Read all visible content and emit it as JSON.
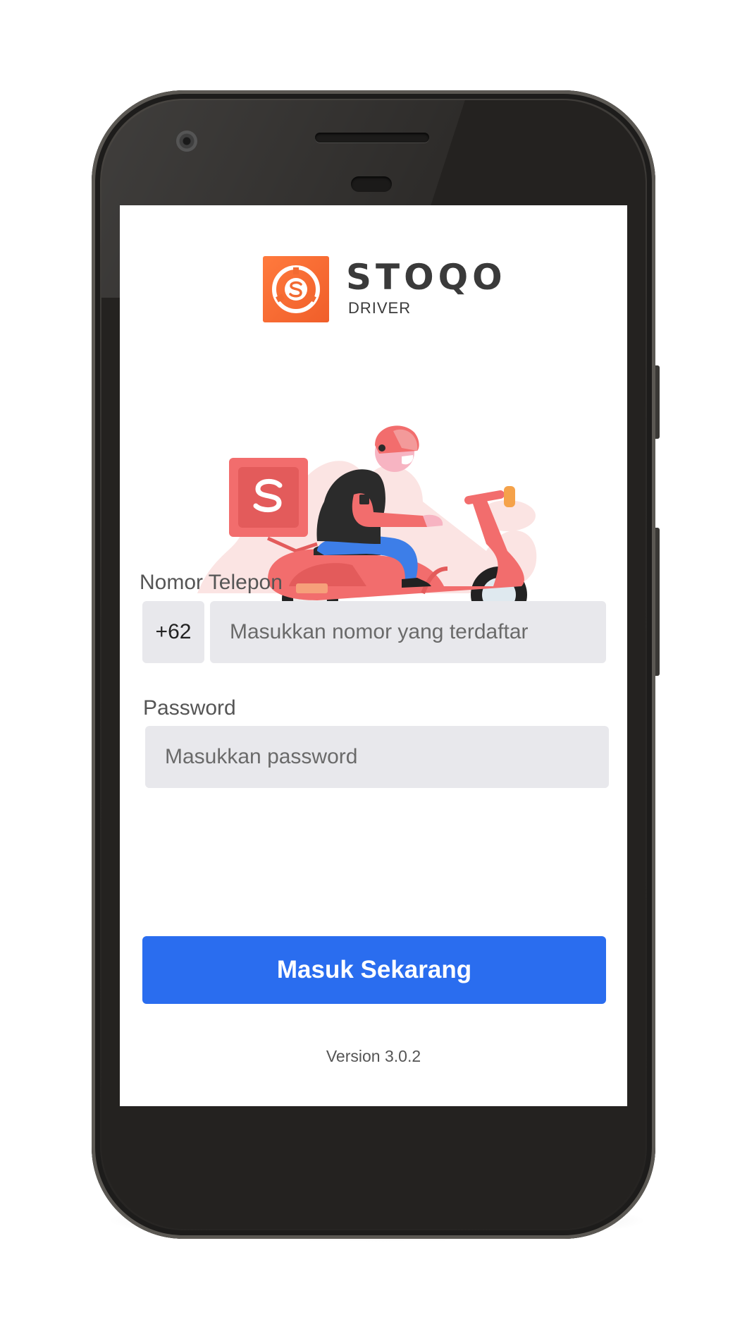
{
  "app": {
    "brand_name": "STOQO",
    "brand_sub": "DRIVER"
  },
  "login": {
    "phone_label": "Nomor Telepon",
    "country_code": "+62",
    "phone_placeholder": "Masukkan nomor yang terdaftar",
    "password_label": "Password",
    "password_placeholder": "Masukkan password",
    "submit_label": "Masuk Sekarang",
    "version": "Version 3.0.2"
  },
  "colors": {
    "brand_orange": "#f26a32",
    "primary_button": "#2a6def",
    "field_background": "#e8e8ec",
    "illustration_red": "#f26d6d"
  },
  "icons": {
    "logo": "stoqo-logo-icon",
    "illustration": "scooter-courier-illustration"
  }
}
